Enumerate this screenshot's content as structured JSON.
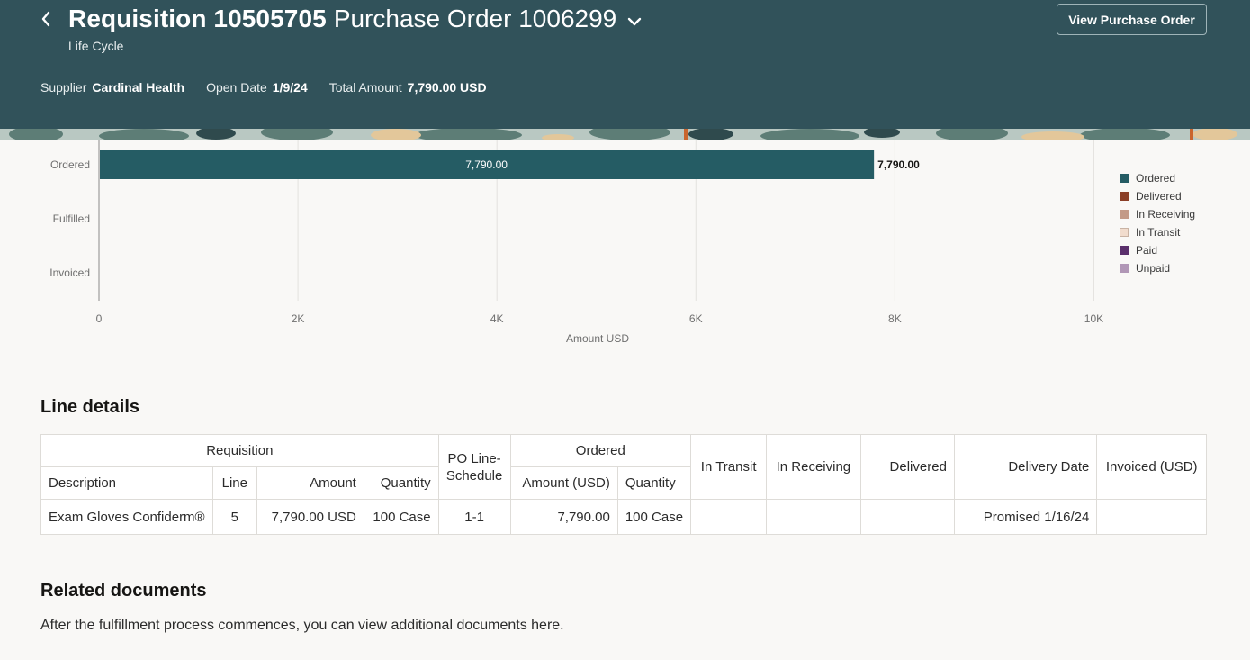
{
  "header": {
    "title_bold": "Requisition 10505705",
    "title_rest": "Purchase Order 1006299",
    "subtitle": "Life Cycle",
    "view_po_label": "View Purchase Order",
    "supplier_label": "Supplier",
    "supplier_value": "Cardinal Health",
    "open_date_label": "Open Date",
    "open_date_value": "1/9/24",
    "total_label": "Total Amount",
    "total_value": "7,790.00 USD"
  },
  "colors": {
    "header_bg": "#31525a",
    "ordered": "#255c64",
    "delivered": "#8b3f27",
    "in_receiving": "#c39a87",
    "in_transit": "#f1dccd",
    "paid": "#5a2f6b",
    "unpaid": "#b197b6"
  },
  "chart_data": {
    "type": "bar",
    "orientation": "horizontal",
    "categories": [
      "Ordered",
      "Fulfilled",
      "Invoiced"
    ],
    "series": [
      {
        "name": "Ordered",
        "values": [
          7790,
          null,
          null
        ],
        "label": "7,790.00"
      }
    ],
    "totals": [
      "7,790.00",
      "",
      ""
    ],
    "xlabel": "Amount USD",
    "xlim": [
      0,
      11000
    ],
    "xticks": [
      0,
      2000,
      4000,
      6000,
      8000,
      10000
    ],
    "xtick_labels": [
      "0",
      "2K",
      "4K",
      "6K",
      "8K",
      "10K"
    ],
    "grid": true,
    "legend_position": "right",
    "legend": [
      "Ordered",
      "Delivered",
      "In Receiving",
      "In Transit",
      "Paid",
      "Unpaid"
    ]
  },
  "line_details": {
    "title": "Line details",
    "group_headers": {
      "requisition": "Requisition",
      "po_line_schedule": "PO Line-Schedule",
      "ordered": "Ordered",
      "in_transit": "In Transit",
      "in_receiving": "In Receiving",
      "delivered": "Delivered",
      "delivery_date": "Delivery Date",
      "invoiced": "Invoiced (USD)"
    },
    "sub_headers": {
      "description": "Description",
      "line": "Line",
      "amount": "Amount",
      "quantity": "Quantity",
      "ordered_amount": "Amount (USD)",
      "ordered_quantity": "Quantity"
    },
    "rows": [
      {
        "description": "Exam Gloves Confiderm®",
        "line": "5",
        "amount": "7,790.00 USD",
        "quantity": "100 Case",
        "po_line_schedule": "1-1",
        "ordered_amount": "7,790.00",
        "ordered_quantity": "100 Case",
        "in_transit": "",
        "in_receiving": "",
        "delivered": "",
        "delivery_date": "Promised 1/16/24",
        "invoiced": ""
      }
    ]
  },
  "related": {
    "title": "Related documents",
    "text": "After the fulfillment process commences, you can view additional documents here."
  }
}
